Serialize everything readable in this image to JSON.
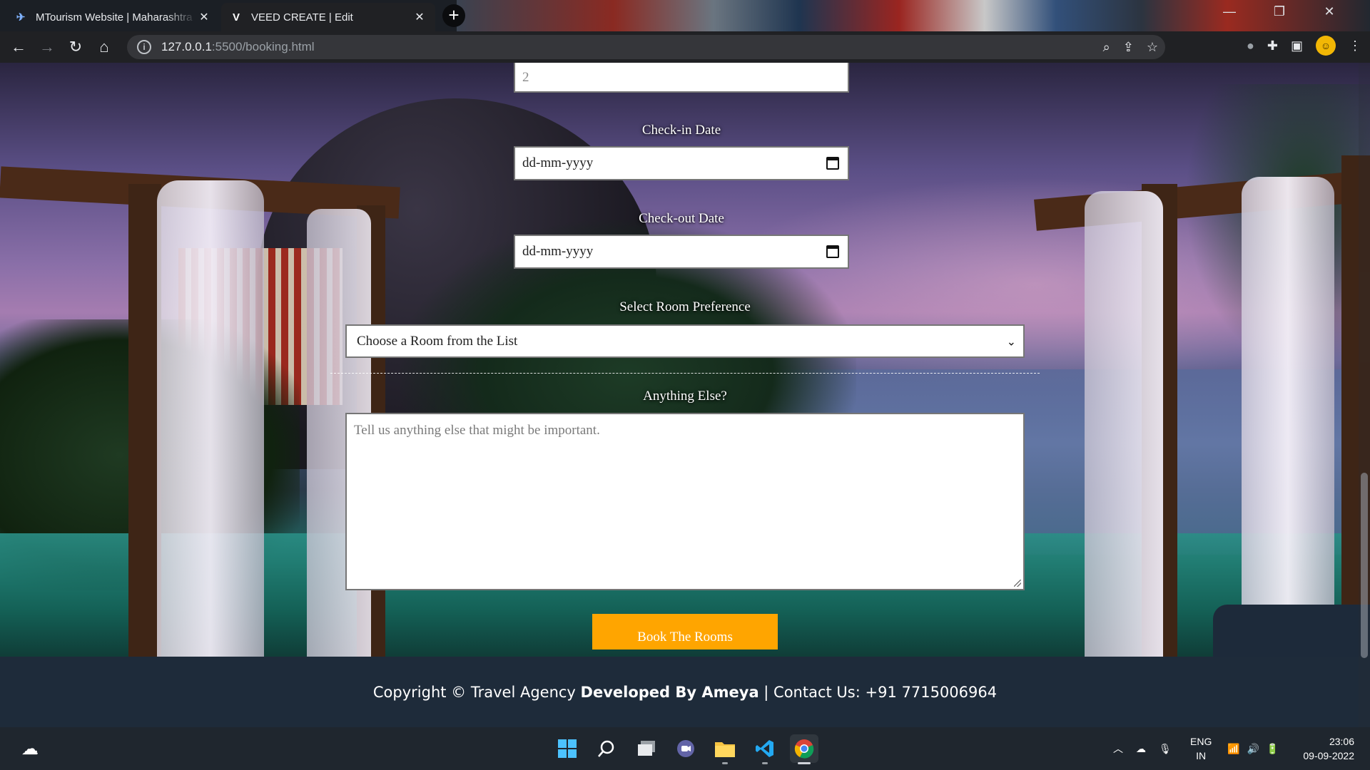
{
  "browser": {
    "tabs": [
      {
        "title": "MTourism Website | Maharashtra",
        "favicon": "plane-icon",
        "active": false
      },
      {
        "title": "VEED CREATE | Edit",
        "favicon": "veed-v-icon",
        "active": true
      }
    ],
    "new_tab_symbol": "+",
    "url_host": "127.0.0.1",
    "url_path": ":5500/booking.html"
  },
  "form": {
    "guests_value": "2",
    "checkin_label": "Check-in Date",
    "checkin_value": "dd-mm-yyyy",
    "checkout_label": "Check-out Date",
    "checkout_value": "dd-mm-yyyy",
    "room_label": "Select Room Preference",
    "room_selected": "Choose a Room from the List",
    "anything_label": "Anything Else?",
    "anything_placeholder": "Tell us anything else that might be important.",
    "submit_label": "Book The Rooms",
    "submit_color": "#ffa500"
  },
  "footer": {
    "prefix": "Copyright © Travel Agency ",
    "developer": "Developed By Ameya",
    "suffix": " | Contact Us: +91 7715006964",
    "background": "#1e2b3a"
  },
  "taskbar": {
    "apps": [
      "start-icon",
      "search-icon",
      "task-view-icon",
      "teams-chat-icon",
      "file-explorer-icon",
      "vscode-icon",
      "chrome-icon"
    ],
    "language_line1": "ENG",
    "language_line2": "IN",
    "time": "23:06",
    "date": "09-09-2022"
  }
}
